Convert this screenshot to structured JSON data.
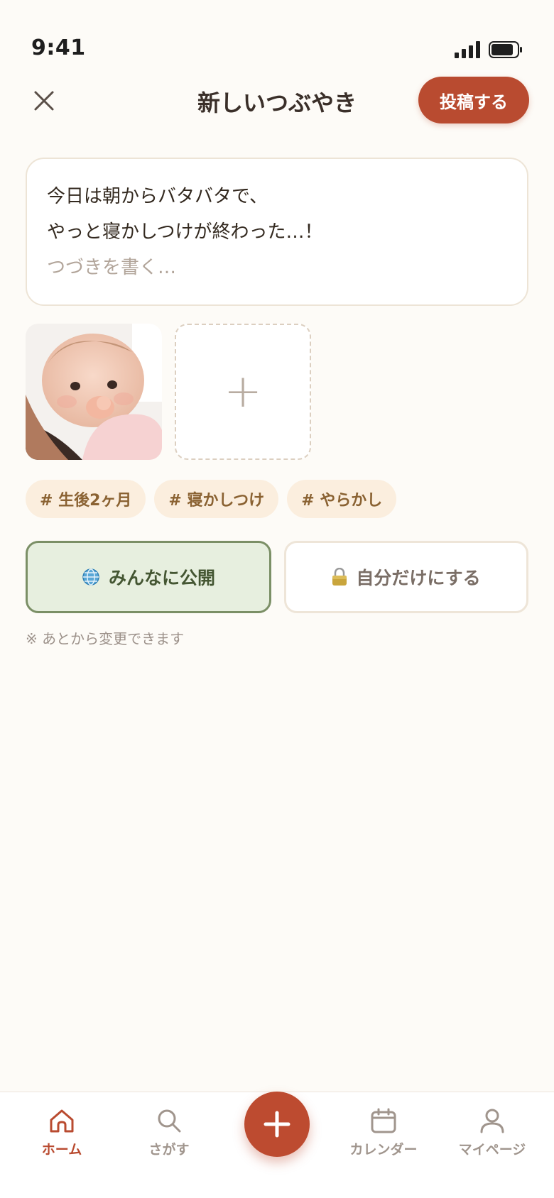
{
  "status_bar": {
    "time": "9:41",
    "battery_level": 0.85
  },
  "header": {
    "title": "新しいつぶやき",
    "post_label": "投稿する"
  },
  "composer": {
    "lines": [
      "今日は朝からバタバタで、",
      "やっと寝かしつけが終わった…！"
    ],
    "placeholder": "つづきを書く…"
  },
  "photos": {
    "add_label": "+"
  },
  "tags": [
    "# 生後2ヶ月",
    "# 寝かしつけ",
    "# やらかし"
  ],
  "visibility": {
    "public_label": "みんなに公開",
    "private_label": "自分だけにする",
    "public_icon": "globe-icon",
    "private_icon": "lock-icon",
    "note": "※ あとから変更できます"
  },
  "nav": {
    "items": [
      {
        "label": "ホーム",
        "icon": "home-icon",
        "active": true
      },
      {
        "label": "さがす",
        "icon": "search-icon",
        "active": false
      },
      {
        "label": "カレンダー",
        "icon": "calendar-icon",
        "active": false
      },
      {
        "label": "マイページ",
        "icon": "user-icon",
        "active": false
      }
    ],
    "fab_icon": "plus-icon"
  },
  "colors": {
    "accent": "#b94b30",
    "public_bg": "#e7efdf",
    "public_border": "#7b8f66",
    "tag_bg": "#fbeede",
    "tag_text": "#8a6232",
    "background": "#fdfbf7"
  }
}
